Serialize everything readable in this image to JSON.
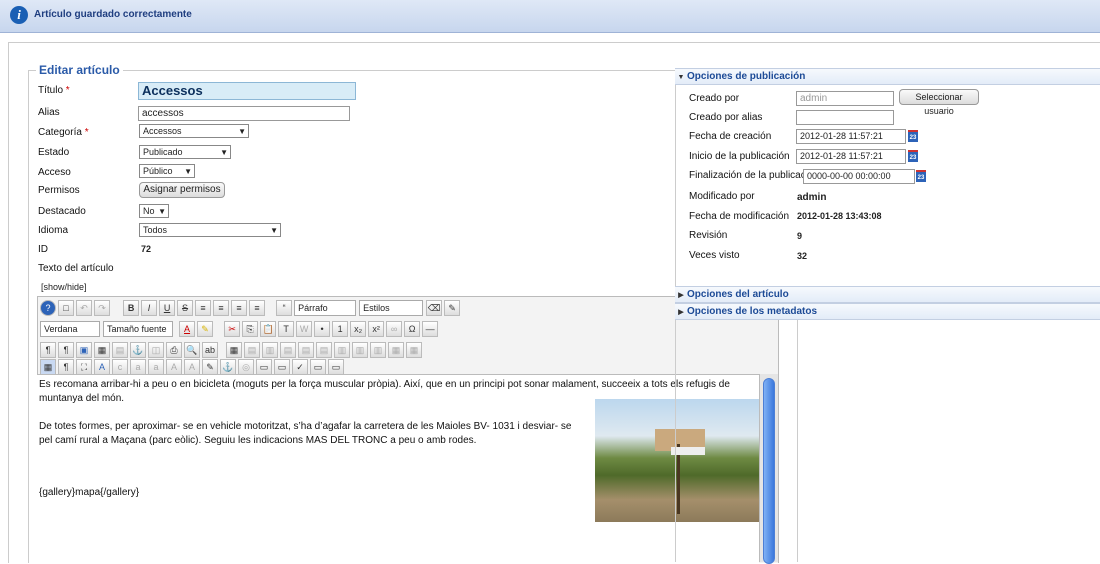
{
  "message": {
    "text": "Artículo guardado correctamente"
  },
  "form": {
    "legend": "Editar artículo",
    "fields": {
      "titulo": {
        "label": "Título",
        "value": "Accessos"
      },
      "alias": {
        "label": "Alias",
        "value": "accessos"
      },
      "categoria": {
        "label": "Categoría",
        "value": "Accessos"
      },
      "estado": {
        "label": "Estado",
        "value": "Publicado"
      },
      "acceso": {
        "label": "Acceso",
        "value": "Público"
      },
      "permisos": {
        "label": "Permisos",
        "button": "Asignar permisos"
      },
      "destacado": {
        "label": "Destacado",
        "value": "No"
      },
      "idioma": {
        "label": "Idioma",
        "value": "Todos"
      },
      "id": {
        "label": "ID",
        "value": "72"
      },
      "texto": {
        "label": "Texto del artículo"
      }
    },
    "show_hide": "[show/hide]",
    "required_mark": "*"
  },
  "editor": {
    "format_select": "Párrafo",
    "styles_select": "Estilos",
    "font_select": "Verdana",
    "size_select": "Tamaño fuente",
    "paragraph1": "Es recomana arribar-hi a peu o en bicicleta (moguts per la força muscular pròpia). Així, que en un principi pot sonar malament, succeeix a tots els refugis de muntanya del món.",
    "paragraph2": "De totes formes, per aproximar- se en vehicle motoritzat, s’ha d’agafar la carretera de les Maioles BV- 1031 i desviar- se pel camí rural a Maçana (parc eòlic). Seguiu les indicacions MAS DEL TRONC a peu o amb rodes.",
    "paragraph3": "{gallery}mapa{/gallery}"
  },
  "publishing": {
    "header": "Opciones de publicación",
    "creado_por": {
      "label": "Creado por",
      "value": "admin",
      "button": "Seleccionar usuario"
    },
    "creado_alias": {
      "label": "Creado por alias",
      "value": ""
    },
    "fecha_creacion": {
      "label": "Fecha de creación",
      "value": "2012-01-28 11:57:21"
    },
    "inicio_publicacion": {
      "label": "Inicio de la publicación",
      "value": "2012-01-28 11:57:21"
    },
    "fin_publicacion": {
      "label": "Finalización de la publicación",
      "value": "0000-00-00 00:00:00"
    },
    "modificado_por": {
      "label": "Modificado por",
      "value": "admin"
    },
    "fecha_modificacion": {
      "label": "Fecha de modificación",
      "value": "2012-01-28 13:43:08"
    },
    "revision": {
      "label": "Revisión",
      "value": "9"
    },
    "veces_visto": {
      "label": "Veces visto",
      "value": "32"
    },
    "calendar_glyph": "23"
  },
  "panels": {
    "article_options": "Opciones del artículo",
    "metadata_options": "Opciones de los metadatos"
  }
}
